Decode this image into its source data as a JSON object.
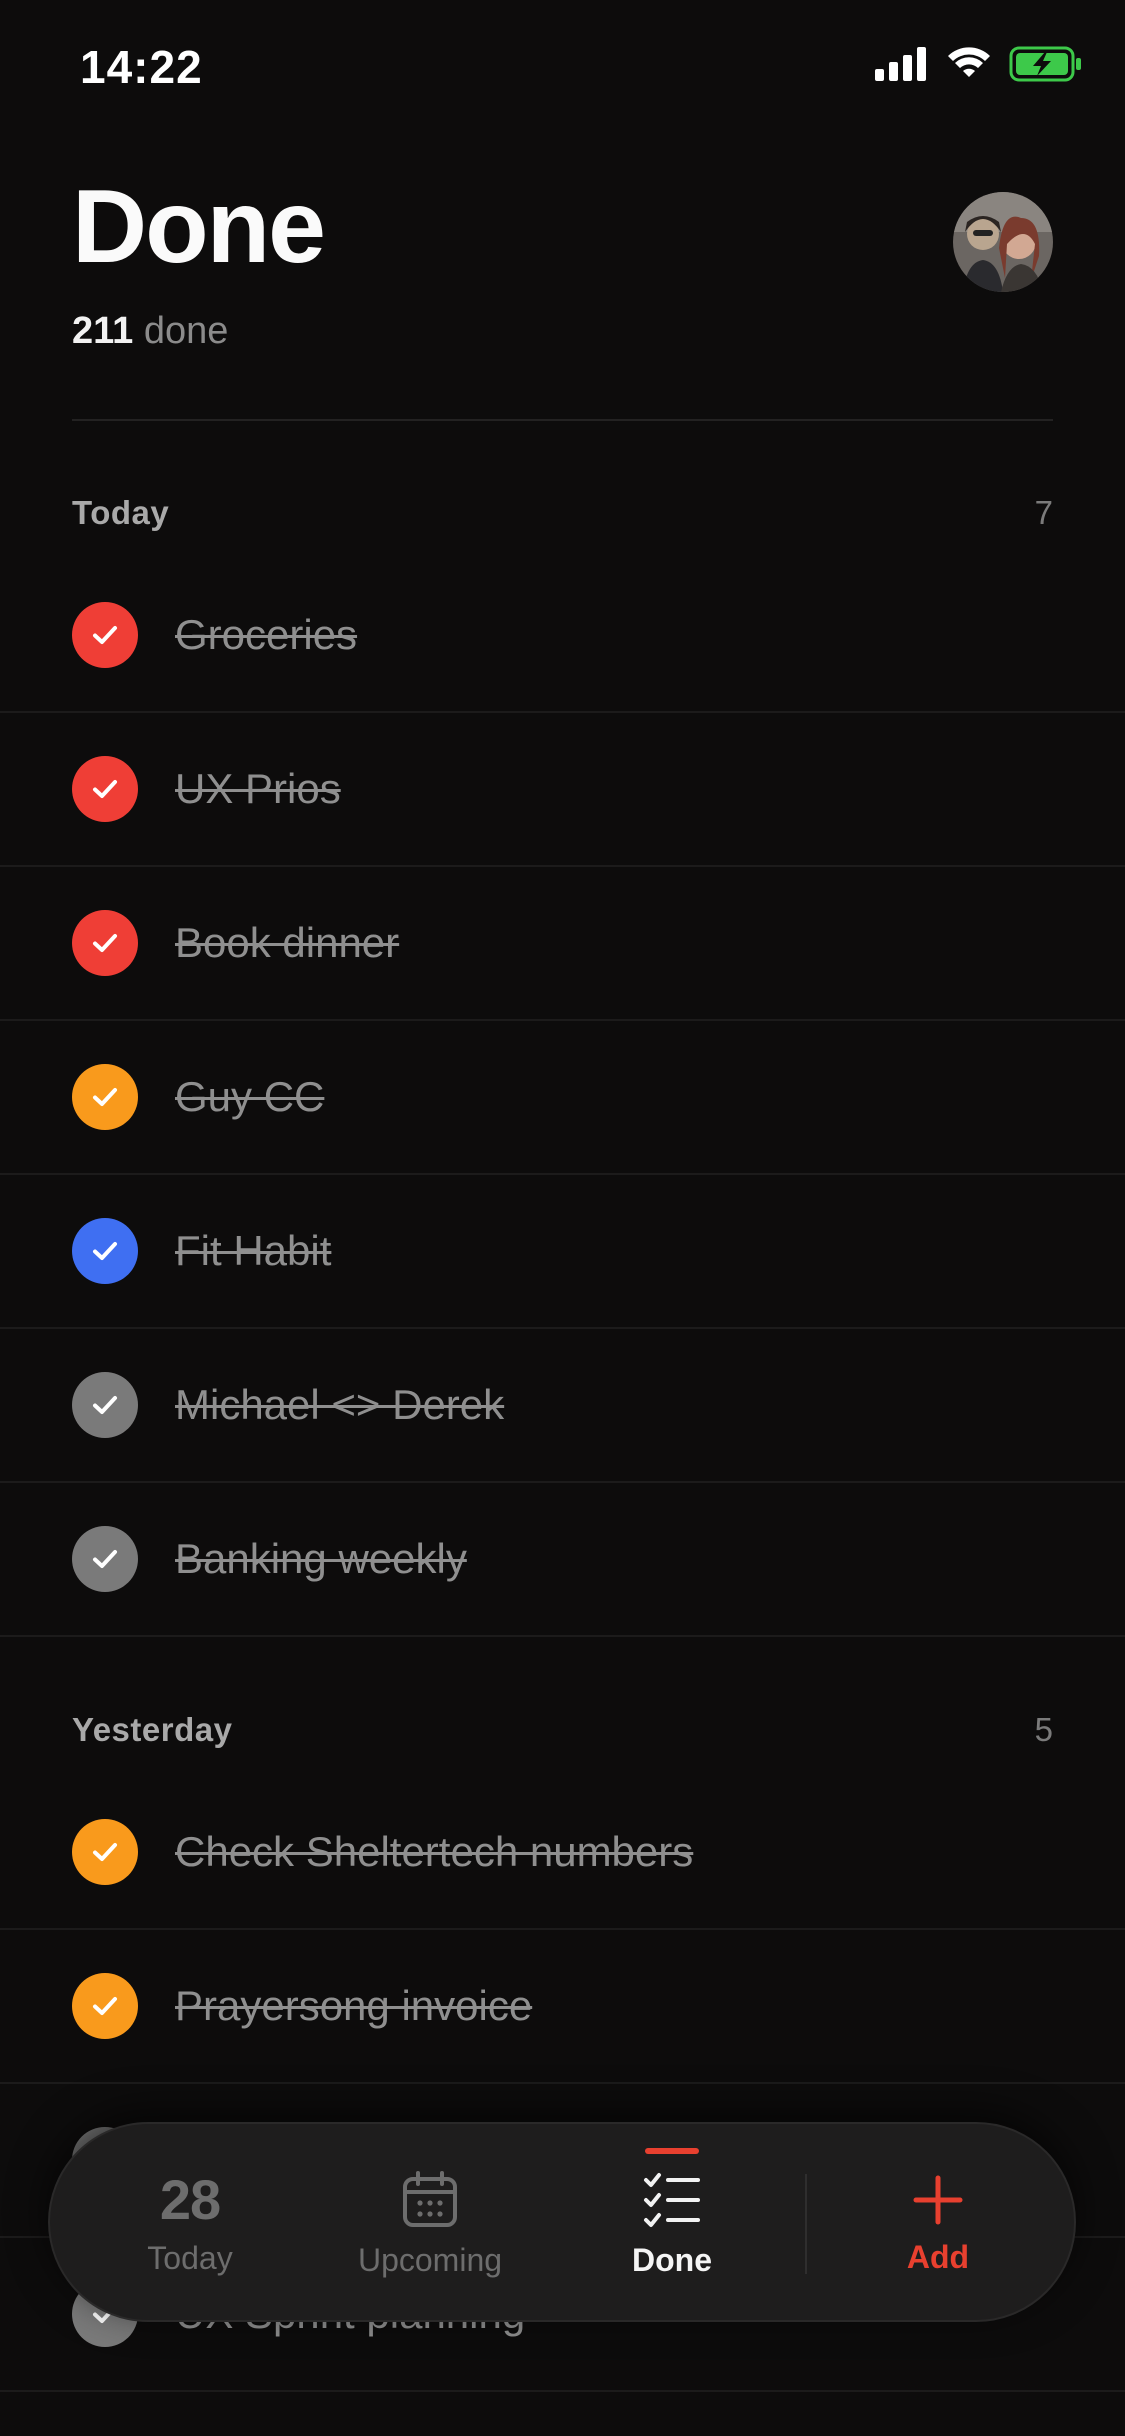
{
  "status_bar": {
    "time": "14:22"
  },
  "header": {
    "title": "Done",
    "done_count": "211",
    "done_label": "done"
  },
  "sections": [
    {
      "title": "Today",
      "count": "7",
      "tasks": [
        {
          "title": "Groceries",
          "color": "#ef3e36"
        },
        {
          "title": "UX Prios",
          "color": "#ef3e36"
        },
        {
          "title": "Book dinner",
          "color": "#ef3e36"
        },
        {
          "title": "Guy CC",
          "color": "#f99a1c"
        },
        {
          "title": "Fit Habit",
          "color": "#3f6ff2"
        },
        {
          "title": "Michael <> Derek",
          "color": "#7a7a7a"
        },
        {
          "title": "Banking weekly",
          "color": "#7a7a7a"
        }
      ]
    },
    {
      "title": "Yesterday",
      "count": "5",
      "tasks": [
        {
          "title": "Check Sheltertech numbers",
          "color": "#f99a1c"
        },
        {
          "title": "Prayersong invoice",
          "color": "#f99a1c"
        },
        {
          "title": "",
          "color": "#7a7a7a"
        },
        {
          "title": "UX Sprint planning",
          "color": "#7a7a7a"
        }
      ]
    }
  ],
  "tab_bar": {
    "today": {
      "day": "28",
      "label": "Today"
    },
    "upcoming": {
      "label": "Upcoming",
      "icon": "calendar-icon"
    },
    "done": {
      "label": "Done",
      "icon": "checklist-icon"
    },
    "add": {
      "label": "Add",
      "icon": "plus-icon"
    },
    "active_tab": "done"
  },
  "colors": {
    "accent": "#e8402f",
    "red": "#ef3e36",
    "orange": "#f99a1c",
    "blue": "#3f6ff2",
    "gray": "#7a7a7a"
  }
}
